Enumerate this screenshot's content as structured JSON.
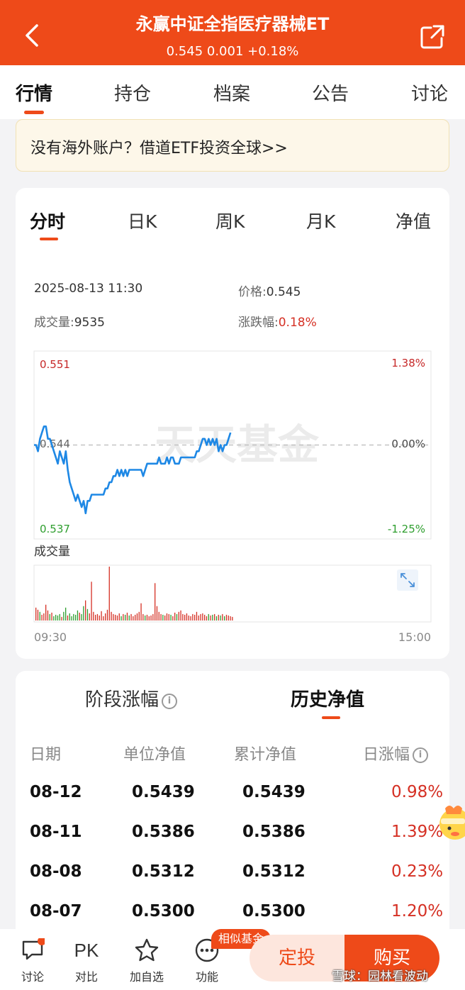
{
  "header": {
    "title": "永赢中证全指医疗器械ET",
    "quote": "0.545 0.001 +0.18%"
  },
  "tabs": [
    "行情",
    "持仓",
    "档案",
    "公告",
    "讨论"
  ],
  "banner": {
    "text": "没有海外账户？借道ETF投资全球>>"
  },
  "chart_tabs": [
    "分时",
    "日K",
    "周K",
    "月K",
    "净值"
  ],
  "info": {
    "datetime": "2025-08-13 11:30",
    "price_label": "价格:",
    "price_value": "0.545",
    "volume_label": "成交量:",
    "volume_value": "9535",
    "change_label": "涨跌幅:",
    "change_value": "0.18%"
  },
  "chart_labels": {
    "y_high": "0.551",
    "y_mid": "0.544",
    "y_low": "0.537",
    "pct_high": "1.38%",
    "pct_mid": "0.00%",
    "pct_low": "-1.25%",
    "volume_title": "成交量",
    "time_start": "09:30",
    "time_end": "15:00",
    "watermark": "天天基金"
  },
  "chart_data": {
    "type": "line",
    "title": "",
    "xlabel": "",
    "ylabel": "",
    "x_range": [
      "09:30",
      "15:00"
    ],
    "ylim": [
      0.537,
      0.551
    ],
    "reference_price": 0.544,
    "colors": {
      "line": "#1e88e5",
      "up": "#d53024",
      "down": "#2e9e2e"
    },
    "series": [
      {
        "values": [
          0.544,
          0.544,
          0.5435,
          0.5445,
          0.545,
          0.5455,
          0.5455,
          0.5445,
          0.5445,
          0.544,
          0.5435,
          0.543,
          0.5425,
          0.5435,
          0.543,
          0.5425,
          0.5435,
          0.542,
          0.541,
          0.5405,
          0.54,
          0.5395,
          0.54,
          0.5395,
          0.539,
          0.5395,
          0.5385,
          0.5395,
          0.5395,
          0.54,
          0.54,
          0.54,
          0.54,
          0.54,
          0.54,
          0.54,
          0.5405,
          0.5405,
          0.541,
          0.541,
          0.5415,
          0.5415,
          0.542,
          0.5415,
          0.542,
          0.5415,
          0.542,
          0.5415,
          0.542,
          0.542,
          0.542,
          0.542,
          0.542,
          0.542,
          0.542,
          0.5415,
          0.542,
          0.5425,
          0.5425,
          0.5425,
          0.5425,
          0.5425,
          0.5425,
          0.543,
          0.5425,
          0.5425,
          0.5425,
          0.543,
          0.5425,
          0.543,
          0.543,
          0.5425,
          0.5425,
          0.5425,
          0.543,
          0.543,
          0.543,
          0.543,
          0.543,
          0.543,
          0.543,
          0.543,
          0.5435,
          0.5435,
          0.544,
          0.5445,
          0.5445,
          0.544,
          0.5445,
          0.544,
          0.5445,
          0.544,
          0.5445,
          0.5435,
          0.544,
          0.5435,
          0.544,
          0.544,
          0.5445,
          0.545
        ]
      }
    ],
    "volume": [
      18,
      15,
      12,
      8,
      10,
      22,
      14,
      9,
      11,
      6,
      8,
      7,
      9,
      5,
      12,
      18,
      7,
      10,
      6,
      9,
      8,
      14,
      11,
      9,
      20,
      28,
      16,
      10,
      54,
      12,
      8,
      9,
      7,
      13,
      6,
      10,
      15,
      75,
      12,
      9,
      8,
      7,
      10,
      6,
      9,
      8,
      11,
      7,
      9,
      6,
      8,
      10,
      12,
      24,
      9,
      7,
      8,
      6,
      7,
      9,
      52,
      20,
      12,
      9,
      8,
      7,
      10,
      9,
      8,
      6,
      11,
      9,
      12,
      14,
      9,
      8,
      10,
      7,
      6,
      9,
      8,
      12,
      7,
      9,
      10,
      8,
      6,
      9,
      7,
      8,
      9,
      6,
      8,
      7,
      9,
      6,
      8,
      7,
      6,
      5
    ]
  },
  "history": {
    "tabs": [
      "阶段涨幅",
      "历史净值"
    ],
    "headers": [
      "日期",
      "单位净值",
      "累计净值",
      "日涨幅"
    ],
    "rows": [
      [
        "08-12",
        "0.5439",
        "0.5439",
        "0.98%"
      ],
      [
        "08-11",
        "0.5386",
        "0.5386",
        "1.39%"
      ],
      [
        "08-08",
        "0.5312",
        "0.5312",
        "0.23%"
      ],
      [
        "08-07",
        "0.5300",
        "0.5300",
        "1.20%"
      ]
    ]
  },
  "bottom": {
    "items": [
      {
        "label": "讨论",
        "icon": "chat-icon"
      },
      {
        "label": "对比",
        "icon": "pk-icon",
        "glyph": "PK"
      },
      {
        "label": "加自选",
        "icon": "star-icon"
      },
      {
        "label": "功能",
        "icon": "more-icon"
      }
    ],
    "badge": "相似基金",
    "dingtou": "定投",
    "buy": "购买",
    "watermark": "雪球：园林看波动"
  }
}
